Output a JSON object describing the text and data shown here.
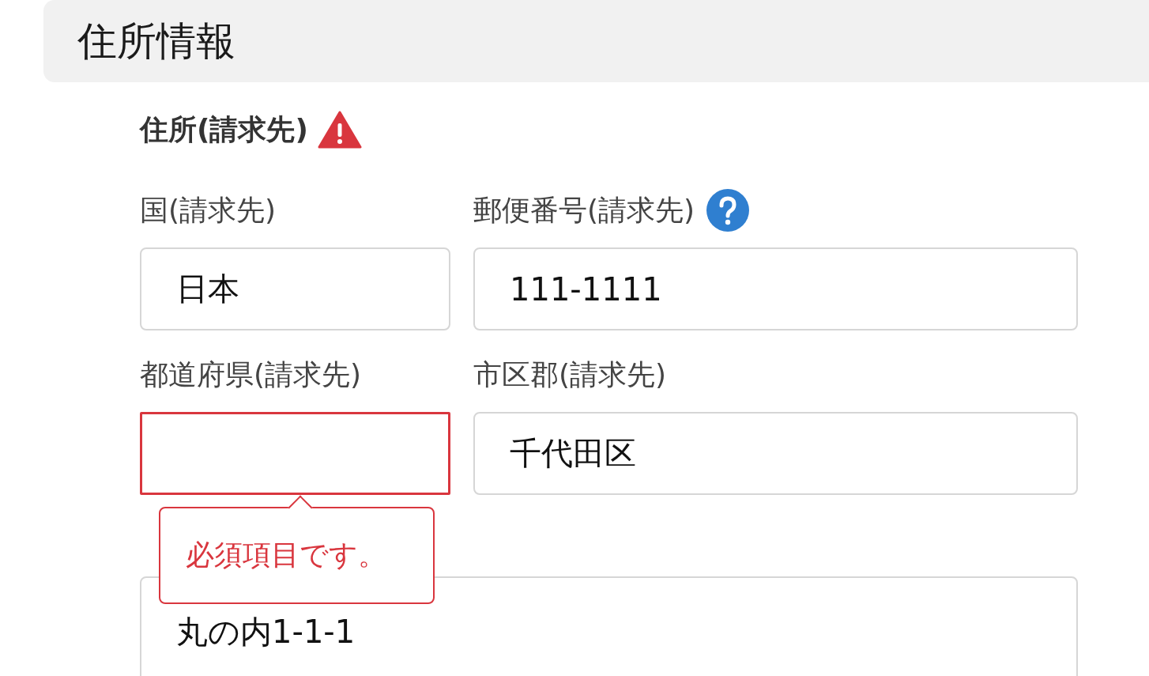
{
  "section": {
    "title": "住所情報"
  },
  "group": {
    "title": "住所(請求先)",
    "warning": true
  },
  "rows": [
    [
      {
        "label": "国(請求先)",
        "value": "日本",
        "help": false,
        "invalid": false
      },
      {
        "label": "郵便番号(請求先)",
        "value": "111-1111",
        "help": true,
        "invalid": false
      }
    ],
    [
      {
        "label": "都道府県(請求先)",
        "help": false,
        "invalid": true,
        "error_message": "必須項目です。"
      },
      {
        "label": "市区郡(請求先)",
        "value": "千代田区",
        "help": false,
        "invalid": false
      }
    ],
    [
      {
        "value": "丸の内1-1-1",
        "help": false,
        "invalid": false
      }
    ]
  ]
}
